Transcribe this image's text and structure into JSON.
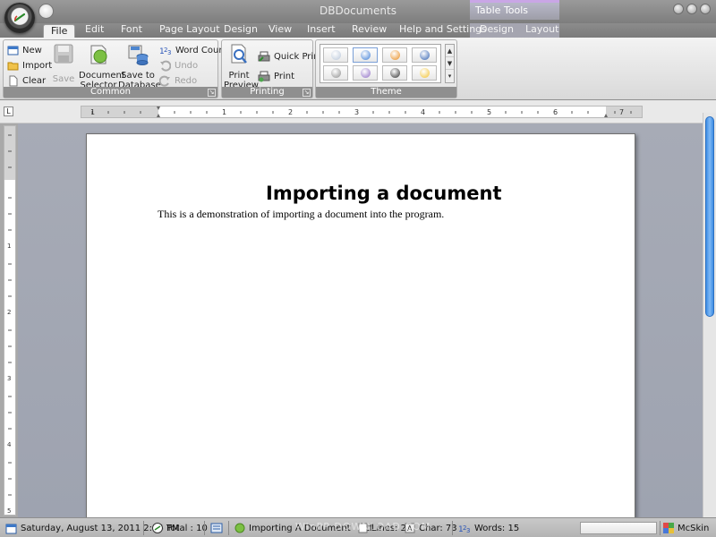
{
  "window": {
    "title": "DBDocuments",
    "context_tab_group": "Table Tools"
  },
  "tabs": [
    {
      "label": "File",
      "active": true
    },
    {
      "label": "Edit"
    },
    {
      "label": "Font"
    },
    {
      "label": "Page Layout"
    },
    {
      "label": "Design"
    },
    {
      "label": "View"
    },
    {
      "label": "Insert"
    },
    {
      "label": "Review"
    },
    {
      "label": "Help and Settings"
    }
  ],
  "context_tabs": [
    {
      "label": "Design"
    },
    {
      "label": "Layout"
    }
  ],
  "ribbon": {
    "common": {
      "label": "Common",
      "new": "New",
      "import": "Import",
      "clear": "Clear",
      "save": "Save",
      "document_selector": "Document Selector",
      "save_to_database": "Save to Database",
      "word_count": "Word Count",
      "undo": "Undo",
      "redo": "Redo"
    },
    "printing": {
      "label": "Printing",
      "print_preview": "Print Preview",
      "quick_print": "Quick Print",
      "print": "Print"
    },
    "theme": {
      "label": "Theme",
      "items": [
        {
          "icon": "globe-icon",
          "color": "#b8c6d9"
        },
        {
          "icon": "office-blue-icon",
          "color": "#3a7bd5"
        },
        {
          "icon": "orange-icon",
          "color": "#e88a1a"
        },
        {
          "icon": "help-sphere-icon",
          "color": "#2f5fb0"
        },
        {
          "icon": "gray-sphere-icon",
          "color": "#8d8d8d"
        },
        {
          "icon": "purple-swirl-icon",
          "color": "#8e6cc4"
        },
        {
          "icon": "dark-sphere-icon",
          "color": "#2b2b2b"
        },
        {
          "icon": "sun-icon",
          "color": "#f2c230"
        }
      ]
    }
  },
  "document": {
    "heading": "Importing a document",
    "paragraph": "This is a demonstration of importing a document into the program."
  },
  "status": {
    "date": "Saturday, August 13, 2011 2:14 PM",
    "total": "Total : 10",
    "doc_name": "Importing A Document",
    "lines": "Lines: 2",
    "chars": "Char: 73",
    "words": "Words: 15",
    "skin": "McSkin"
  },
  "watermark": "WinPP DOWNLOAD.COM"
}
